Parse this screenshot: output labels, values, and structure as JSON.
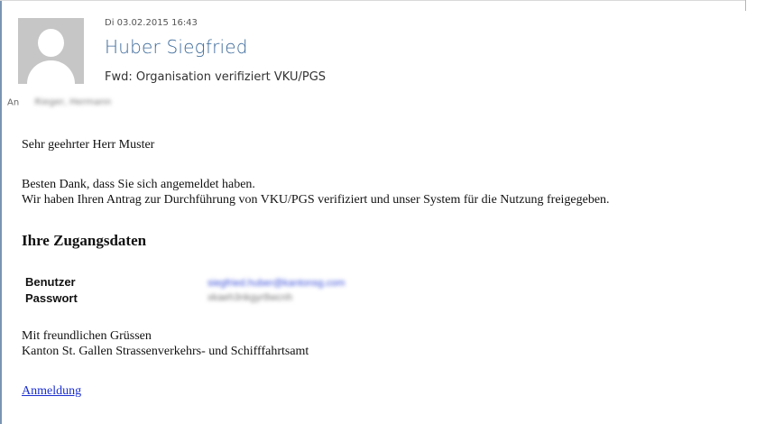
{
  "email": {
    "date": "Di 03.02.2015 16:43",
    "sender": "Huber Siegfried",
    "subject": "Fwd: Organisation verifiziert VKU/PGS",
    "to_label": "An",
    "to_value": "Rieger, Hermann"
  },
  "body": {
    "greeting": "Sehr geehrter Herr Muster",
    "line1": "Besten Dank, dass Sie sich angemeldet haben.",
    "line2": "Wir haben Ihren Antrag zur Durchführung von VKU/PGS verifiziert und unser System für die Nutzung freigegeben.",
    "heading": "Ihre Zugangsdaten",
    "credentials": {
      "user_label": "Benutzer",
      "user_value": "siegfried.huber@kantonsg.com",
      "pass_label": "Passwort",
      "pass_value": "xkaeh3nkgyr8wcnh"
    },
    "closing1": "Mit freundlichen Grüssen",
    "closing2": "Kanton St. Gallen Strassenverkehrs- und Schifffahrtsamt",
    "link": "Anmeldung"
  },
  "colors": {
    "sender": "#3c6a9a",
    "link": "#1b2fcf",
    "avatar_bg": "#c6c6c6"
  }
}
